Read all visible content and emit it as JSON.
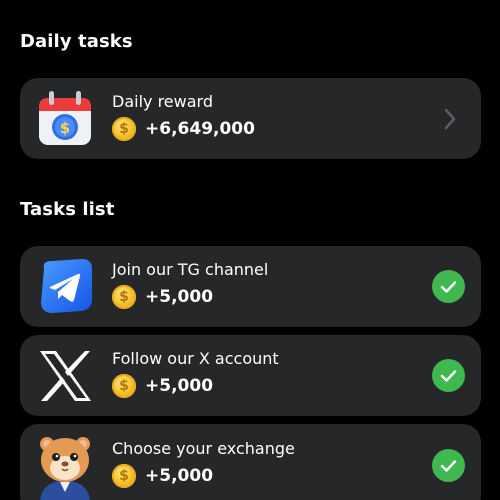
{
  "daily_tasks": {
    "heading": "Daily tasks",
    "reward_card": {
      "title": "Daily reward",
      "amount": "+6,649,000",
      "icon": "calendar-dollar-icon"
    }
  },
  "tasks_list": {
    "heading": "Tasks list",
    "items": [
      {
        "title": "Join our TG channel",
        "amount": "+5,000",
        "icon": "telegram-icon",
        "completed": true
      },
      {
        "title": "Follow our X account",
        "amount": "+5,000",
        "icon": "x-logo-icon",
        "completed": true
      },
      {
        "title": "Choose your exchange",
        "amount": "+5,000",
        "icon": "hamster-icon",
        "completed": true
      }
    ]
  },
  "colors": {
    "background": "#000000",
    "card": "#262729",
    "check": "#3fb94f",
    "coin": "#f7c533",
    "telegram_blue": "#1f6dff"
  },
  "coin_symbol": "$"
}
